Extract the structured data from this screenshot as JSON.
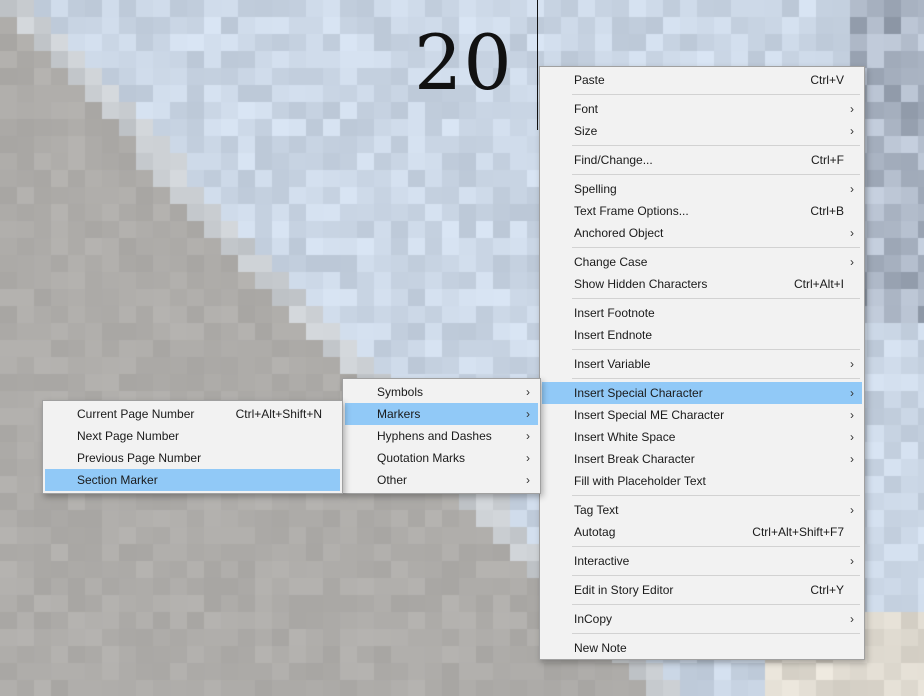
{
  "page": {
    "page_number": "20"
  },
  "main_menu": {
    "groups": [
      [
        {
          "label": "Paste",
          "shortcut": "Ctrl+V"
        }
      ],
      [
        {
          "label": "Font",
          "submenu": true
        },
        {
          "label": "Size",
          "submenu": true
        }
      ],
      [
        {
          "label": "Find/Change...",
          "shortcut": "Ctrl+F"
        }
      ],
      [
        {
          "label": "Spelling",
          "submenu": true
        },
        {
          "label": "Text Frame Options...",
          "shortcut": "Ctrl+B"
        },
        {
          "label": "Anchored Object",
          "submenu": true
        }
      ],
      [
        {
          "label": "Change Case",
          "submenu": true
        },
        {
          "label": "Show Hidden Characters",
          "shortcut": "Ctrl+Alt+I"
        }
      ],
      [
        {
          "label": "Insert Footnote"
        },
        {
          "label": "Insert Endnote"
        }
      ],
      [
        {
          "label": "Insert Variable",
          "submenu": true
        }
      ],
      [
        {
          "label": "Insert Special Character",
          "submenu": true,
          "highlighted": true
        },
        {
          "label": "Insert Special ME Character",
          "submenu": true
        },
        {
          "label": "Insert White Space",
          "submenu": true
        },
        {
          "label": "Insert Break Character",
          "submenu": true
        },
        {
          "label": "Fill with Placeholder Text"
        }
      ],
      [
        {
          "label": "Tag Text",
          "submenu": true
        },
        {
          "label": "Autotag",
          "shortcut": "Ctrl+Alt+Shift+F7"
        }
      ],
      [
        {
          "label": "Interactive",
          "submenu": true
        }
      ],
      [
        {
          "label": "Edit in Story Editor",
          "shortcut": "Ctrl+Y"
        }
      ],
      [
        {
          "label": "InCopy",
          "submenu": true
        }
      ],
      [
        {
          "label": "New Note"
        }
      ]
    ]
  },
  "special_character_menu": {
    "items": [
      {
        "label": "Symbols",
        "submenu": true
      },
      {
        "label": "Markers",
        "submenu": true,
        "highlighted": true
      },
      {
        "label": "Hyphens and Dashes",
        "submenu": true
      },
      {
        "label": "Quotation Marks",
        "submenu": true
      },
      {
        "label": "Other",
        "submenu": true
      }
    ]
  },
  "markers_menu": {
    "items": [
      {
        "label": "Current Page Number",
        "shortcut": "Ctrl+Alt+Shift+N"
      },
      {
        "label": "Next Page Number"
      },
      {
        "label": "Previous Page Number"
      },
      {
        "label": "Section Marker",
        "highlighted": true
      }
    ]
  },
  "icons": {
    "submenu_arrow": "chevron-right-icon"
  },
  "colors": {
    "highlight": "#91c9f7",
    "menu_bg": "#f2f2f2",
    "page_bg": "#c9d9e6"
  }
}
